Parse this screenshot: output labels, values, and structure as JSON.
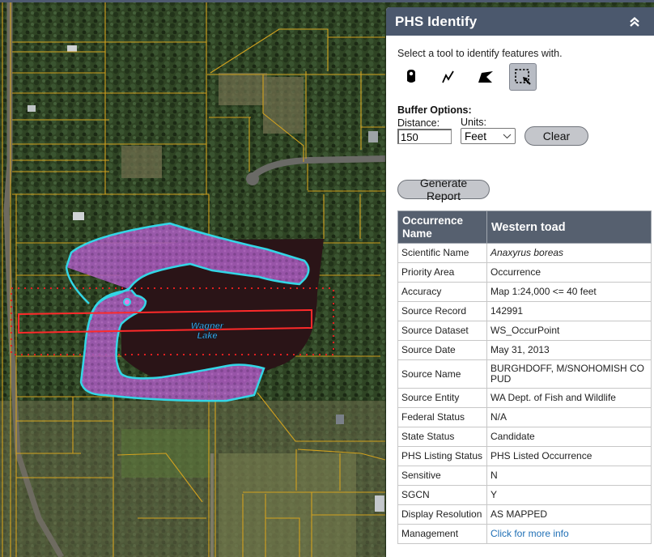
{
  "panel": {
    "title": "PHS Identify",
    "collapse_icon": "double-chevron-up-icon",
    "instructions": "Select a tool to identify features with.",
    "tools": [
      {
        "name": "point",
        "icon": "point-marker-icon",
        "active": false
      },
      {
        "name": "polyline",
        "icon": "polyline-icon",
        "active": false
      },
      {
        "name": "polygon",
        "icon": "polygon-icon",
        "active": false
      },
      {
        "name": "rectangle",
        "icon": "rectangle-select-icon",
        "active": true
      }
    ],
    "buffer": {
      "title": "Buffer Options:",
      "distance_label": "Distance:",
      "distance_value": "150",
      "units_label": "Units:",
      "units_value": "Feet"
    },
    "clear_label": "Clear",
    "generate_label": "Generate Report"
  },
  "results": {
    "header": {
      "label": "Occurrence Name",
      "value": "Western toad"
    },
    "rows": [
      {
        "label": "Scientific Name",
        "value": "Anaxyrus boreas"
      },
      {
        "label": "Priority Area",
        "value": "Occurrence"
      },
      {
        "label": "Accuracy",
        "value": "Map 1:24,000 <= 40 feet"
      },
      {
        "label": "Source Record",
        "value": "142991"
      },
      {
        "label": "Source Dataset",
        "value": "WS_OccurPoint"
      },
      {
        "label": "Source Date",
        "value": "May 31, 2013"
      },
      {
        "label": "Source Name",
        "value": "BURGHDOFF, M/SNOHOMISH CO PUD"
      },
      {
        "label": "Source Entity",
        "value": "WA Dept. of Fish and Wildlife"
      },
      {
        "label": "Federal Status",
        "value": "N/A"
      },
      {
        "label": "State Status",
        "value": "Candidate"
      },
      {
        "label": "PHS Listing Status",
        "value": "PHS Listed Occurrence"
      },
      {
        "label": "Sensitive",
        "value": "N"
      },
      {
        "label": "SGCN",
        "value": "Y"
      },
      {
        "label": "Display Resolution",
        "value": "AS MAPPED"
      },
      {
        "label": "Management",
        "value": "Click for more info"
      }
    ]
  },
  "map": {
    "lake_label_line1": "Wagner",
    "lake_label_line2": "Lake",
    "colors": {
      "habitat_fill": "#b060c8",
      "habitat_outline": "#33d6e6",
      "lake_fill": "#2a1417",
      "selection_rect": "#ff2a2a",
      "buffer_outline": "#e02020",
      "parcel_lines": "#d3a21e",
      "lake_label": "#3aa6e6"
    }
  }
}
